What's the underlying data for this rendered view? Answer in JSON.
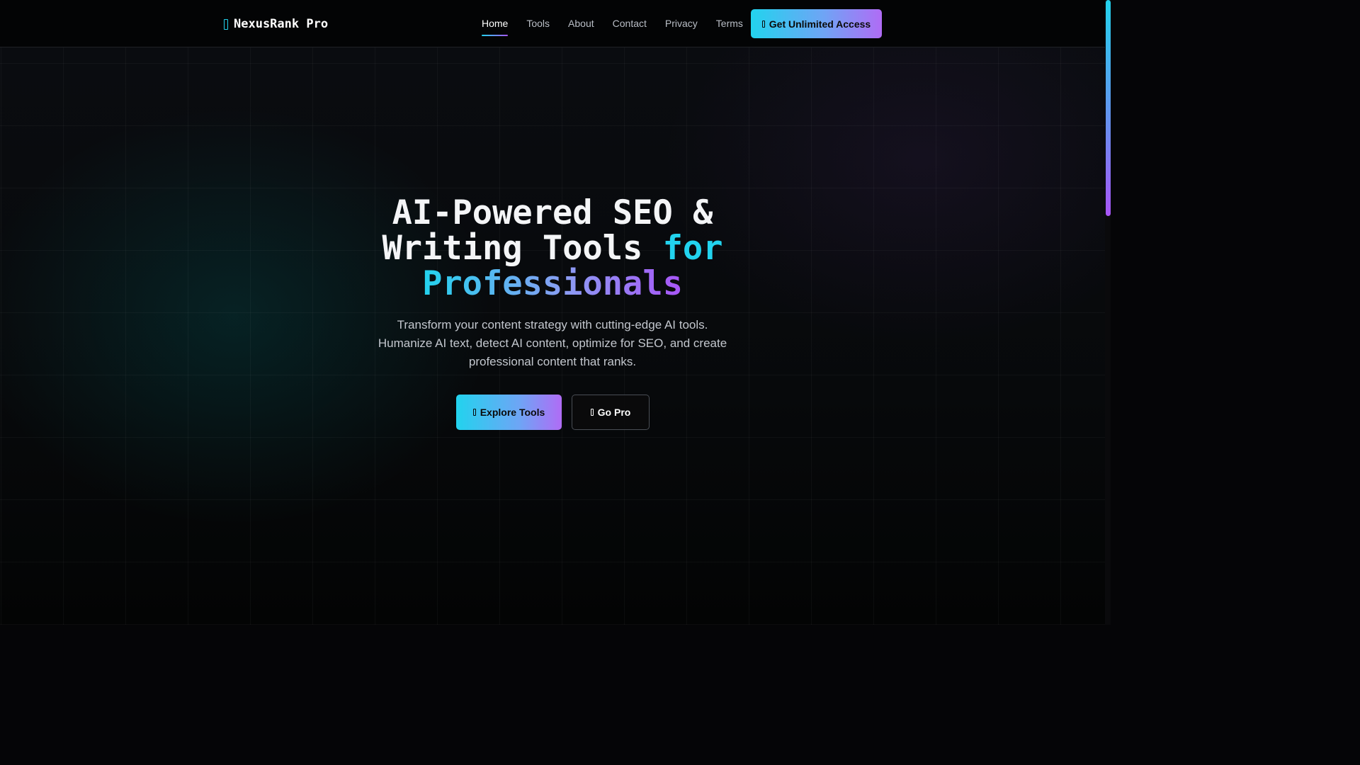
{
  "brand": {
    "name": "NexusRank Pro",
    "icon": "cube-icon"
  },
  "nav": {
    "links": [
      {
        "label": "Home",
        "active": true
      },
      {
        "label": "Tools",
        "active": false
      },
      {
        "label": "About",
        "active": false
      },
      {
        "label": "Contact",
        "active": false
      },
      {
        "label": "Privacy",
        "active": false
      },
      {
        "label": "Terms",
        "active": false
      }
    ],
    "cta": {
      "label": "Get Unlimited Access",
      "icon": "crown-icon"
    }
  },
  "hero": {
    "title_part1": "AI-Powered SEO & Writing Tools ",
    "title_accent1": "for",
    "title_accent2": "Professionals",
    "subtitle": "Transform your content strategy with cutting-edge AI tools. Humanize AI text, detect AI content, optimize for SEO, and create professional content that ranks.",
    "primary_button": {
      "label": "Explore Tools",
      "icon": "rocket-icon"
    },
    "secondary_button": {
      "label": "Go Pro",
      "icon": "crown-icon"
    }
  },
  "colors": {
    "accent_cyan": "#22d3ee",
    "accent_purple": "#a855f7",
    "background": "#050507"
  }
}
